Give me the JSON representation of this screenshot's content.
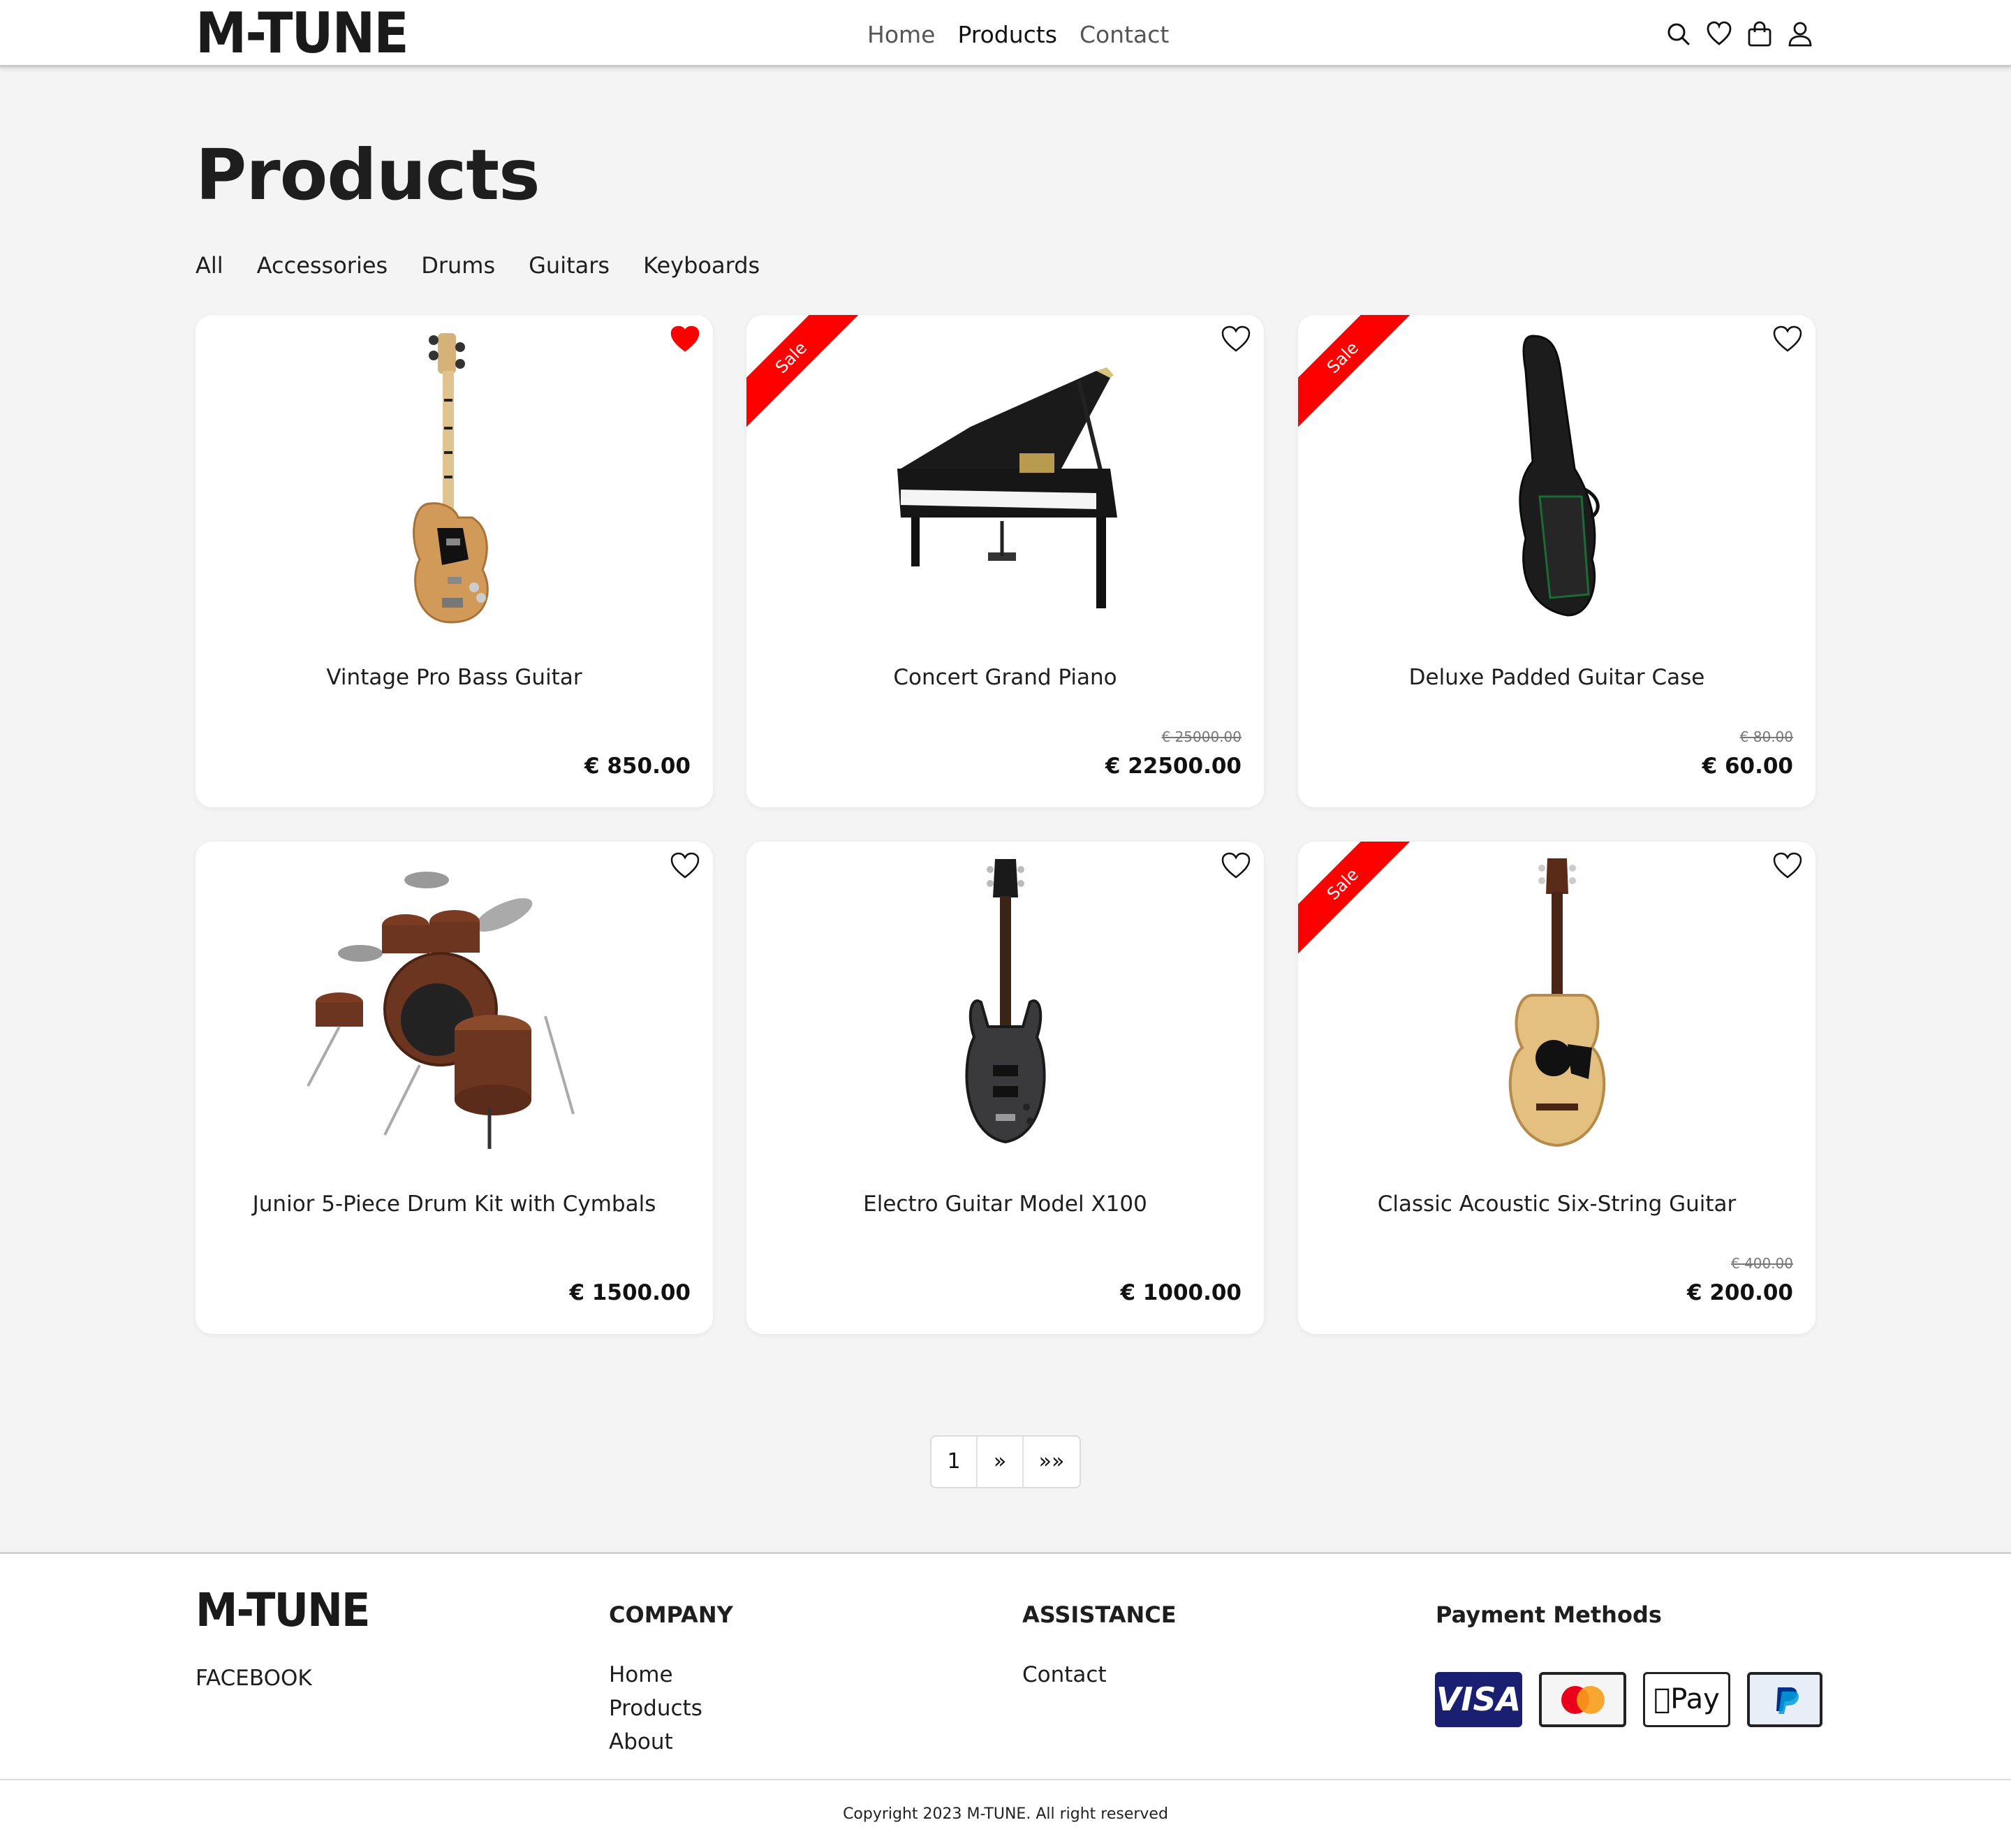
{
  "header": {
    "logo": "M-TUNE",
    "nav": [
      "Home",
      "Products",
      "Contact"
    ],
    "active_nav": "Products",
    "icons": [
      "search-icon",
      "heart-icon",
      "bag-icon",
      "user-icon"
    ]
  },
  "page_title": "Products",
  "filters": [
    "All",
    "Accessories",
    "Drums",
    "Guitars",
    "Keyboards"
  ],
  "sale_label": "Sale",
  "products": [
    {
      "name": "Vintage Pro Bass Guitar",
      "price": "€ 850.00",
      "old_price": "",
      "sale": false,
      "favorite": true,
      "image": "bass-guitar"
    },
    {
      "name": "Concert Grand Piano",
      "price": "€ 22500.00",
      "old_price": "€ 25000.00",
      "sale": true,
      "favorite": false,
      "image": "grand-piano"
    },
    {
      "name": "Deluxe Padded Guitar Case",
      "price": "€ 60.00",
      "old_price": "€ 80.00",
      "sale": true,
      "favorite": false,
      "image": "guitar-case"
    },
    {
      "name": "Junior 5-Piece Drum Kit with Cymbals",
      "price": "€ 1500.00",
      "old_price": "",
      "sale": false,
      "favorite": false,
      "image": "drum-kit"
    },
    {
      "name": "Electro Guitar Model X100",
      "price": "€ 1000.00",
      "old_price": "",
      "sale": false,
      "favorite": false,
      "image": "electric-guitar"
    },
    {
      "name": "Classic Acoustic Six-String Guitar",
      "price": "€ 200.00",
      "old_price": "€ 400.00",
      "sale": true,
      "favorite": false,
      "image": "acoustic-guitar"
    }
  ],
  "pagination": {
    "current": "1",
    "next": "»",
    "last": "»»"
  },
  "footer": {
    "logo": "M-TUNE",
    "social": "FACEBOOK",
    "company_heading": "COMPANY",
    "company_links": [
      "Home",
      "Products",
      "About"
    ],
    "assistance_heading": "ASSISTANCE",
    "assistance_links": [
      "Contact"
    ],
    "payment_heading": "Payment Methods",
    "payment_methods": [
      "VISA",
      "mastercard-icon",
      "Pay",
      "paypal-icon"
    ],
    "copyright": "Copyright 2023 M-TUNE. All right reserved"
  },
  "colors": {
    "sale_ribbon": "#ff0000",
    "favorite_heart": "#ff0000",
    "visa_blue": "#1a1f71"
  }
}
